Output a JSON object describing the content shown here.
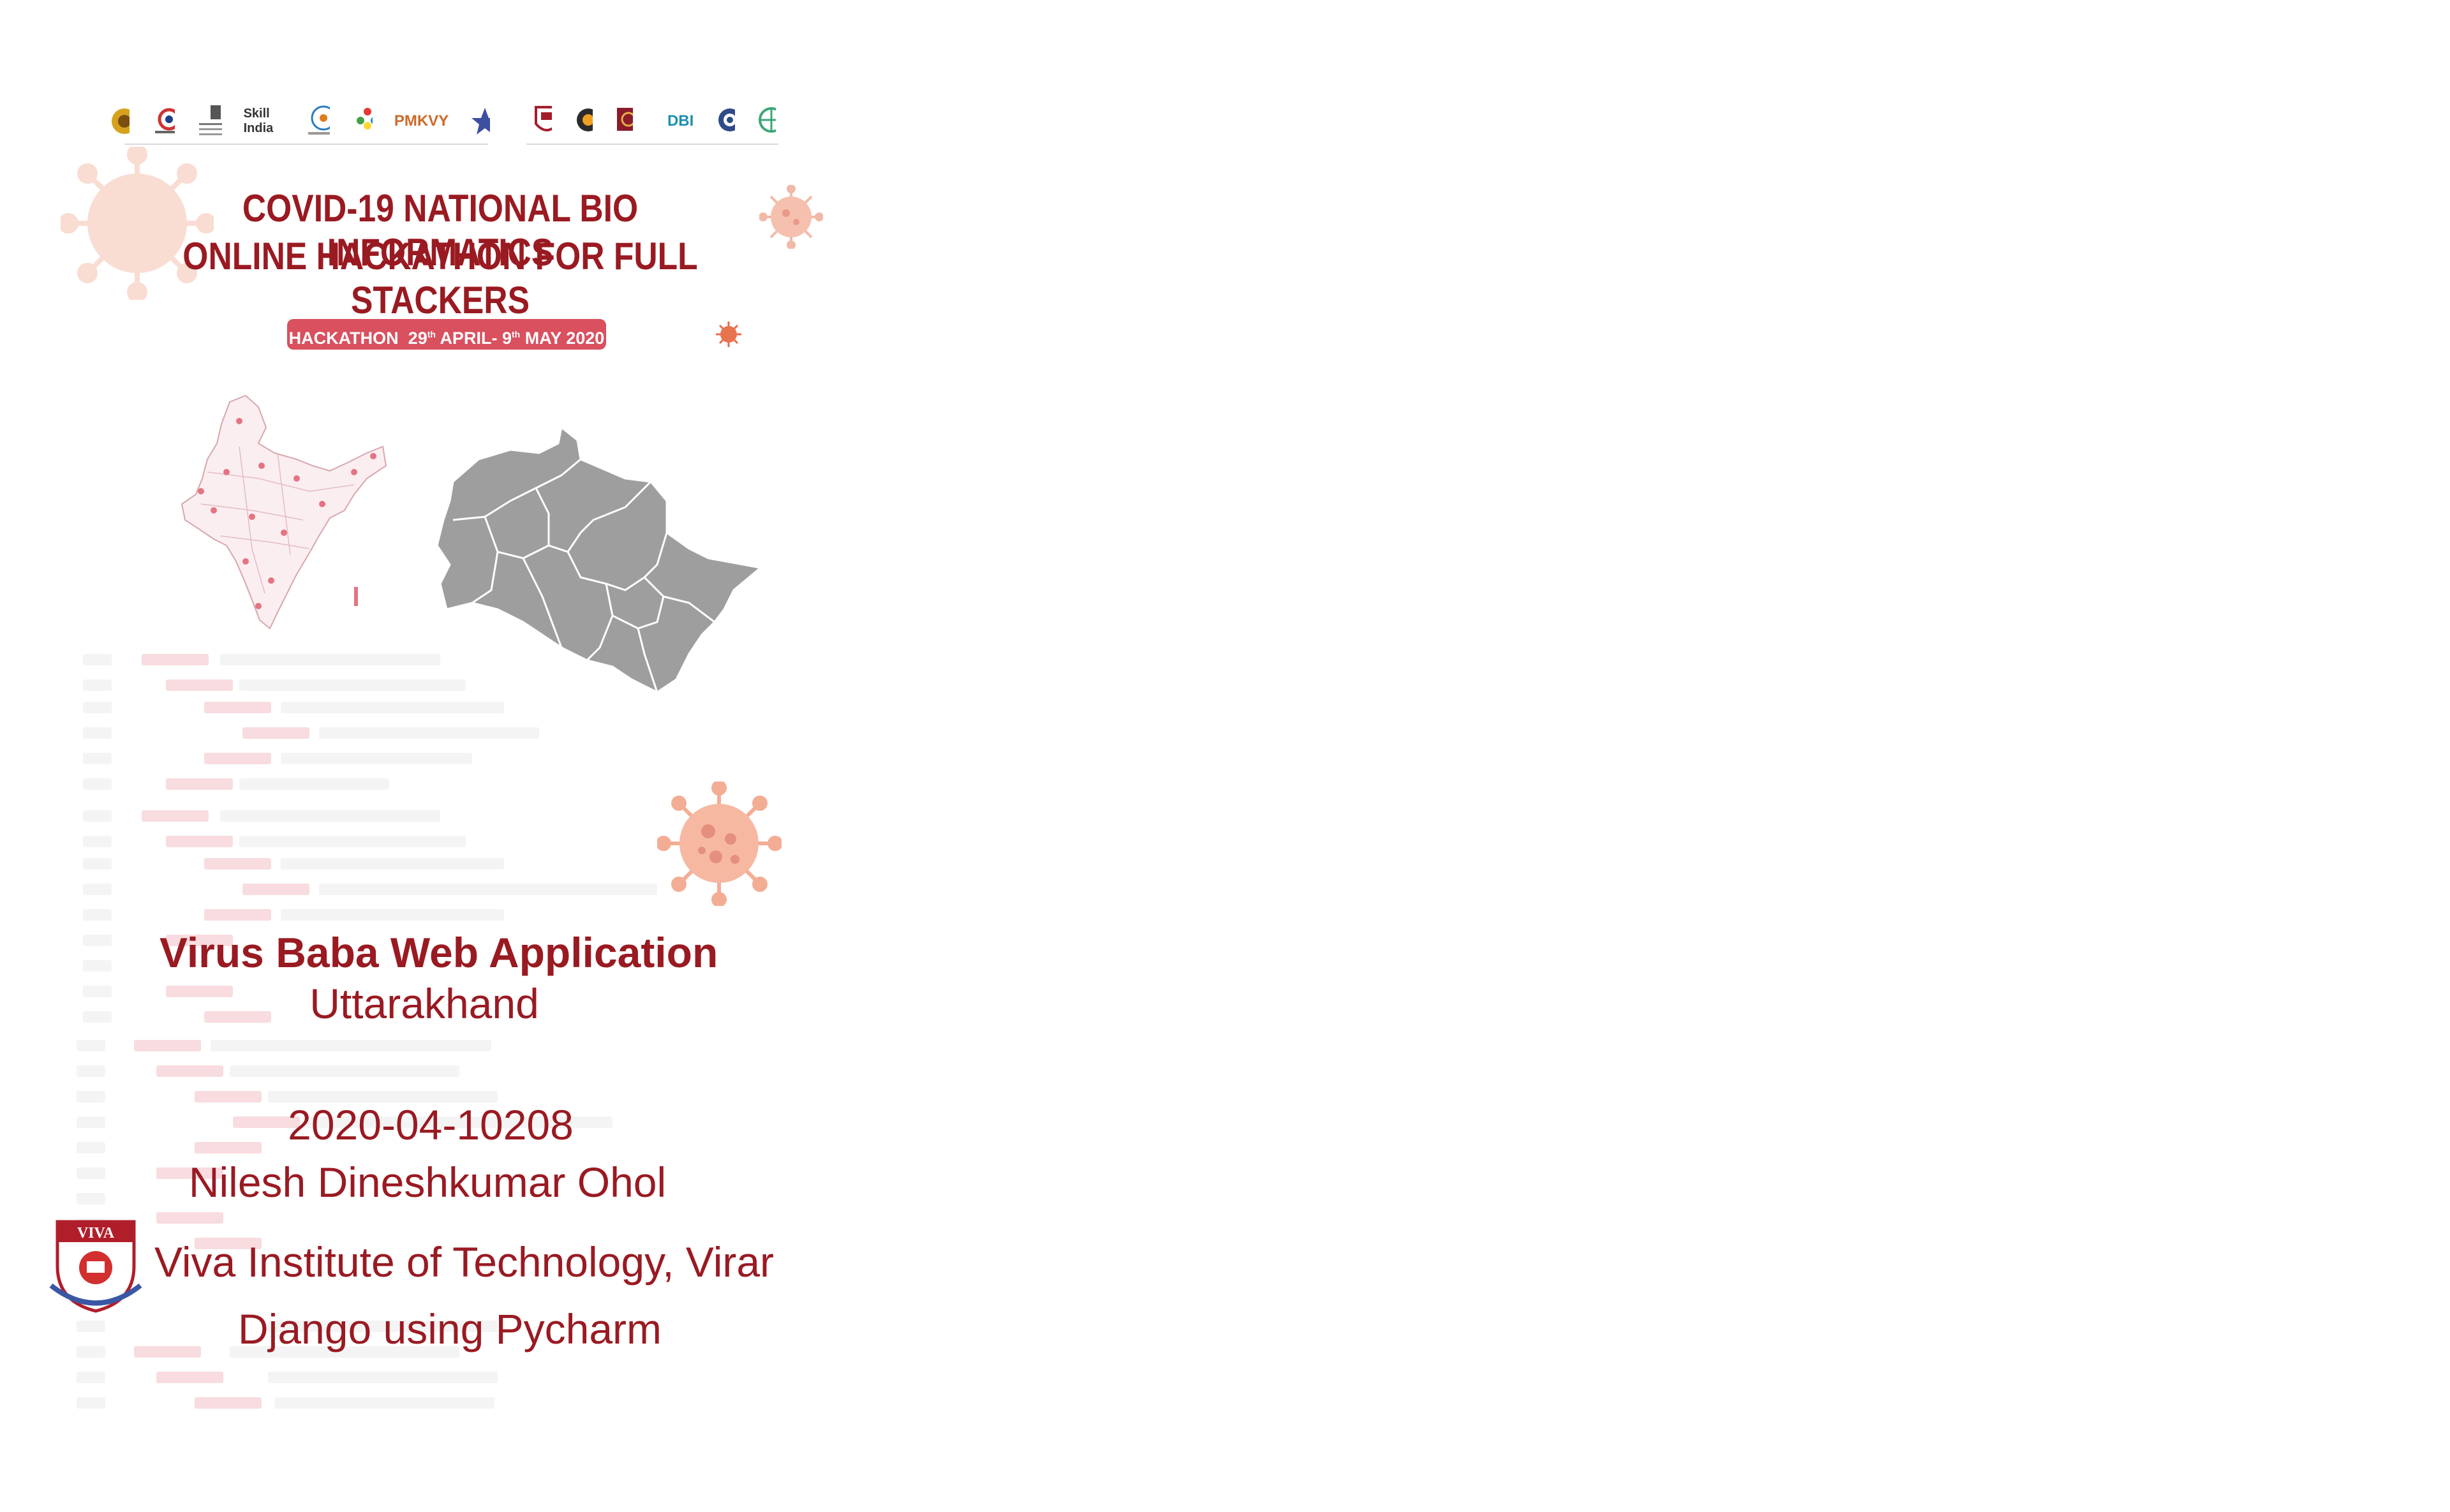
{
  "poster": {
    "title_line1": "COVID-19 NATIONAL BIO INFORMATICS",
    "title_line2": "ONLINE HACKATHON FOR FULL STACKERS",
    "hackathon_label": "HACKATHON",
    "date_start_day": "29",
    "date_start_sup": "th",
    "date_start_month": "APRIL-",
    "date_end_day": "9",
    "date_end_sup": "th",
    "date_end_rest": "MAY 2020",
    "logo_skill_india": "Skill India",
    "logo_pmkvy": "PMKVY",
    "logo_dbi": "DBI"
  },
  "submission": {
    "project_title": "Virus Baba Web Application",
    "state": "Uttarakhand",
    "team_id": "2020-04-10208",
    "team_leader": "Nilesh Dineshkumar Ohol",
    "institute": "Viva Institute of Technology, Virar",
    "technology": "Django using Pycharm",
    "institute_logo_text": "VIVA"
  },
  "colors": {
    "title": "#9a1a22",
    "pill": "#d9505f",
    "virus": "#f2a48c",
    "map_gray": "#9e9e9e"
  }
}
